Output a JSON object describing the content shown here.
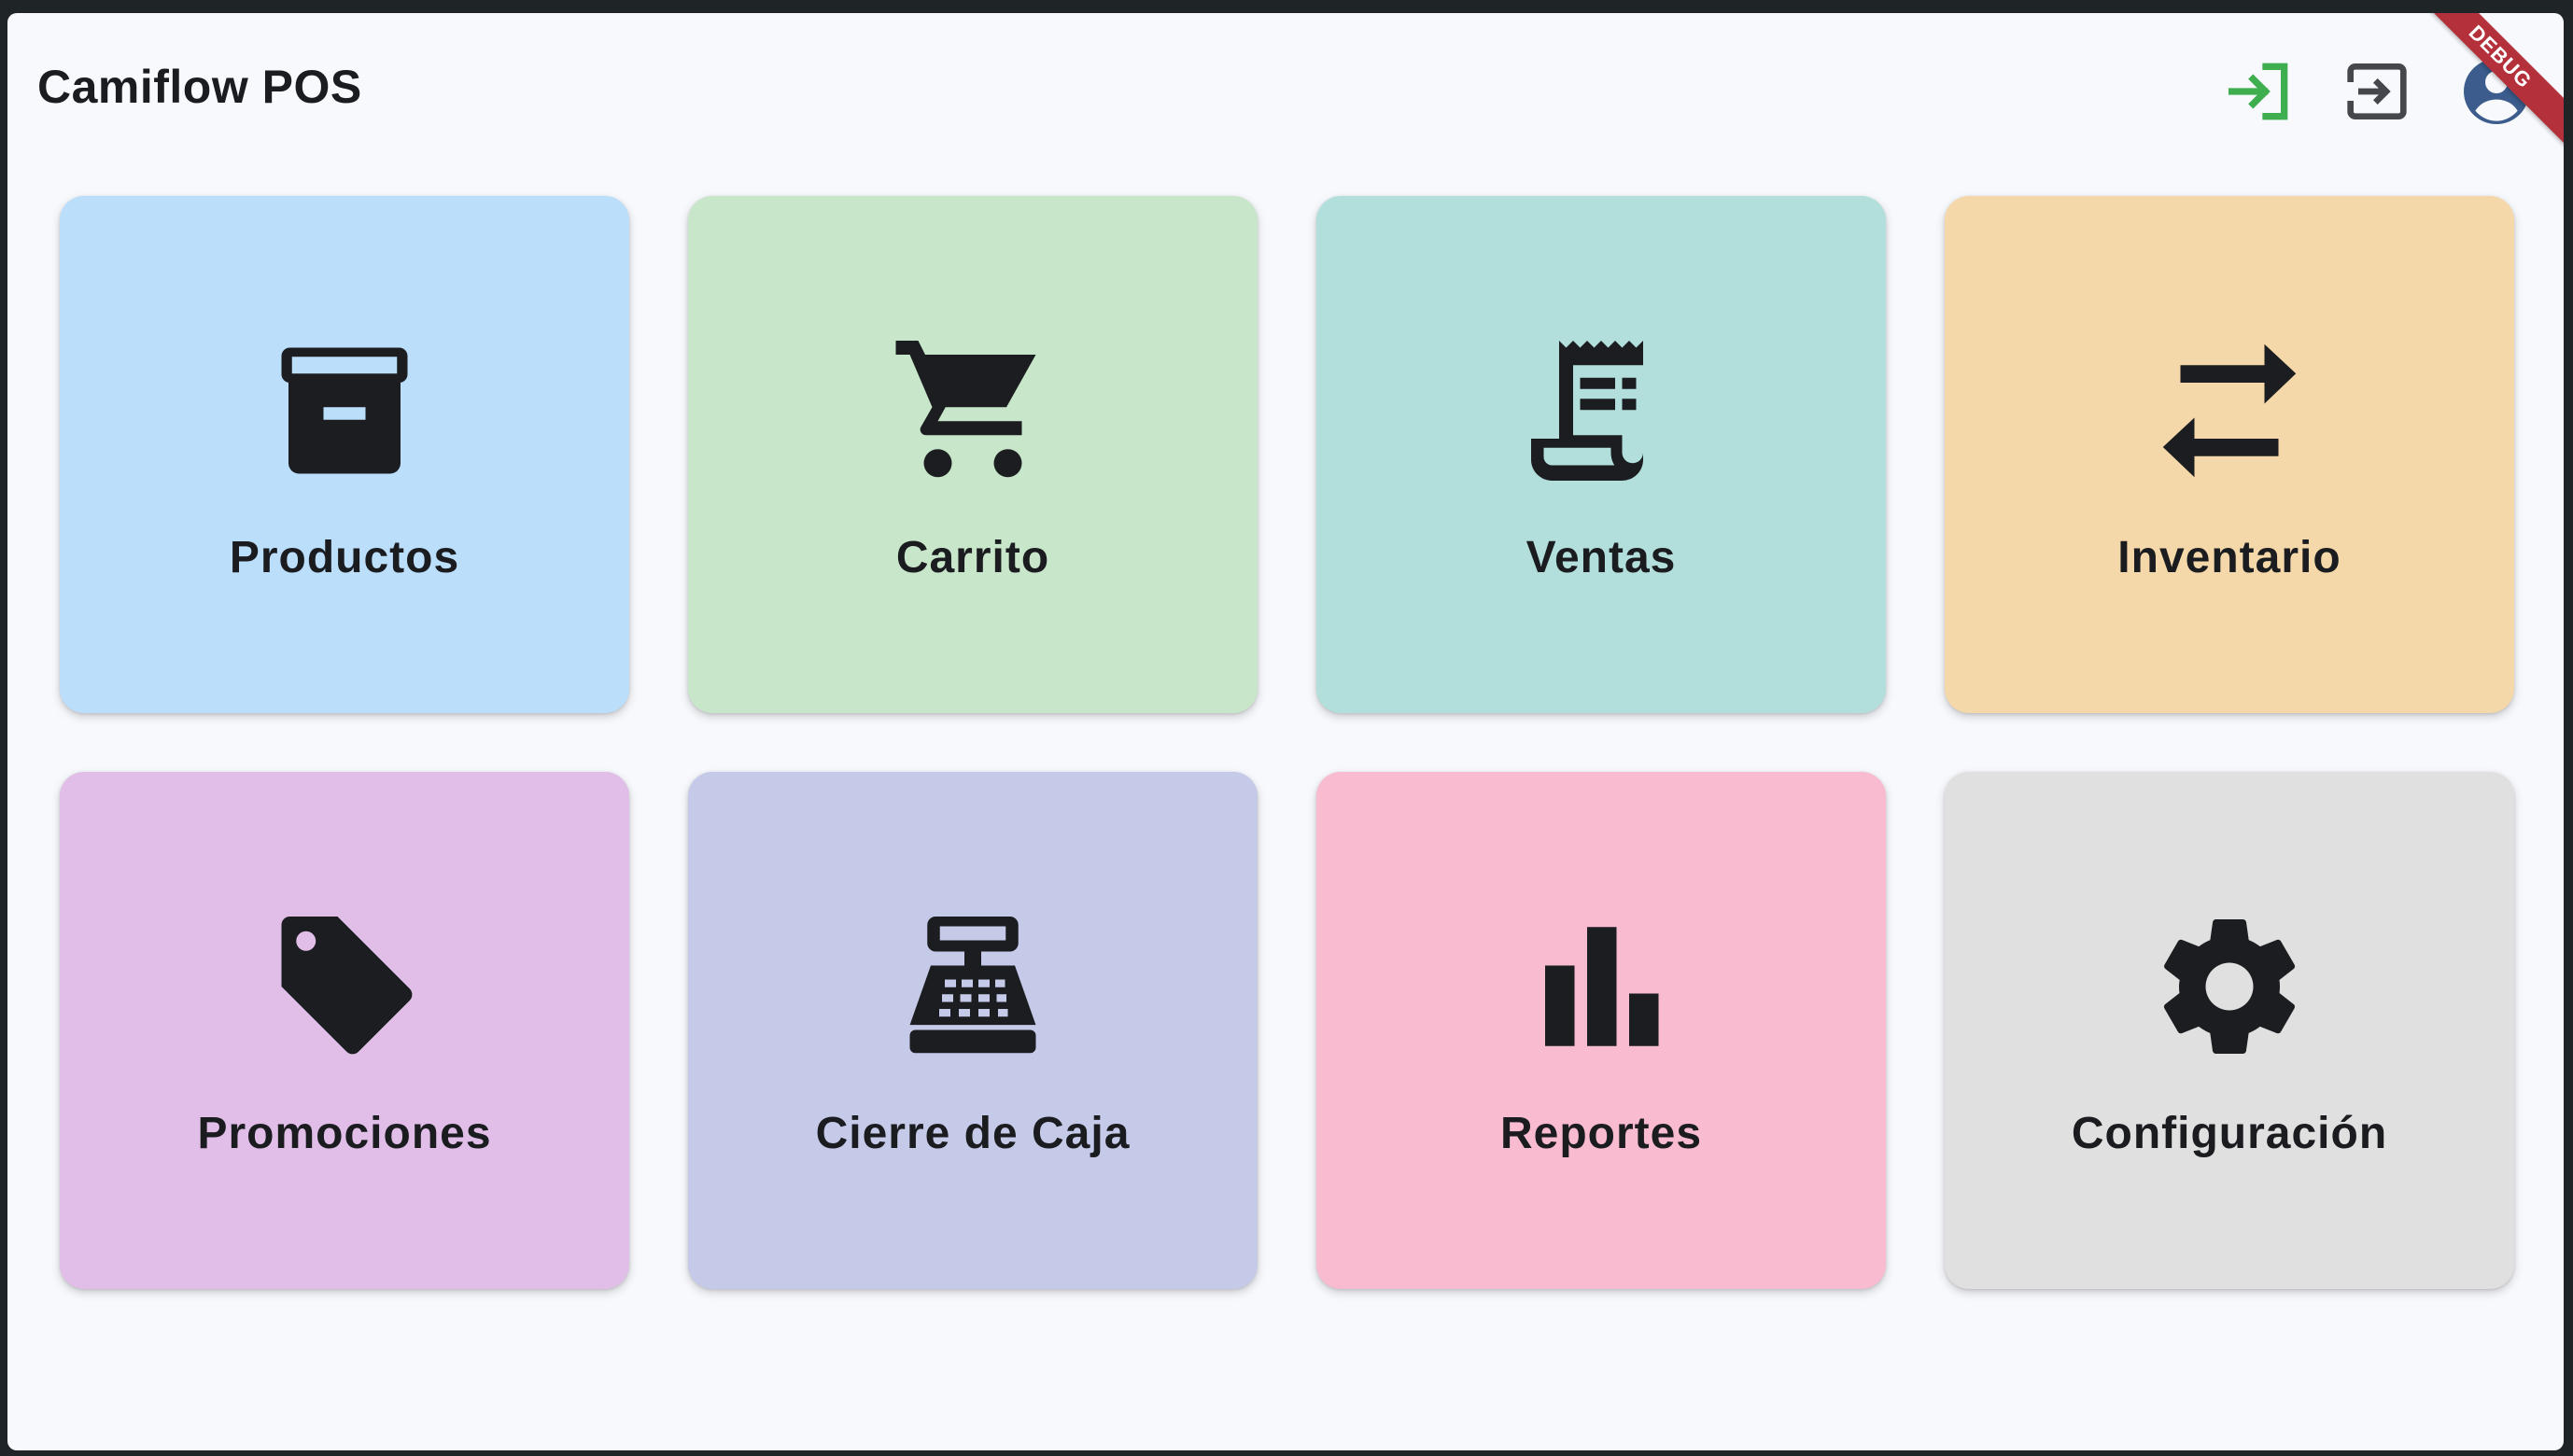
{
  "app": {
    "title": "Camiflow POS",
    "debug_badge": "DEBUG"
  },
  "toolbar": {
    "actions": [
      {
        "icon": "login-icon",
        "color": "#3fae4f"
      },
      {
        "icon": "exit-to-app-icon",
        "color": "#45474d"
      },
      {
        "icon": "account-circle-icon",
        "color": "#3b5c8c"
      }
    ]
  },
  "tiles": [
    {
      "label": "Productos",
      "icon": "archive-box-icon",
      "color": "#bbdefb"
    },
    {
      "label": "Carrito",
      "icon": "shopping-cart-icon",
      "color": "#c8e6c9"
    },
    {
      "label": "Ventas",
      "icon": "receipt-icon",
      "color": "#b2dfdb"
    },
    {
      "label": "Inventario",
      "icon": "swap-arrows-icon",
      "color": "#f5d8a9"
    },
    {
      "label": "Promociones",
      "icon": "tag-icon",
      "color": "#e1bee7"
    },
    {
      "label": "Cierre de Caja",
      "icon": "cash-register-icon",
      "color": "#c5cae9"
    },
    {
      "label": "Reportes",
      "icon": "bar-chart-icon",
      "color": "#f8bbd0"
    },
    {
      "label": "Configuración",
      "icon": "gear-icon",
      "color": "#e0e0e0"
    }
  ]
}
